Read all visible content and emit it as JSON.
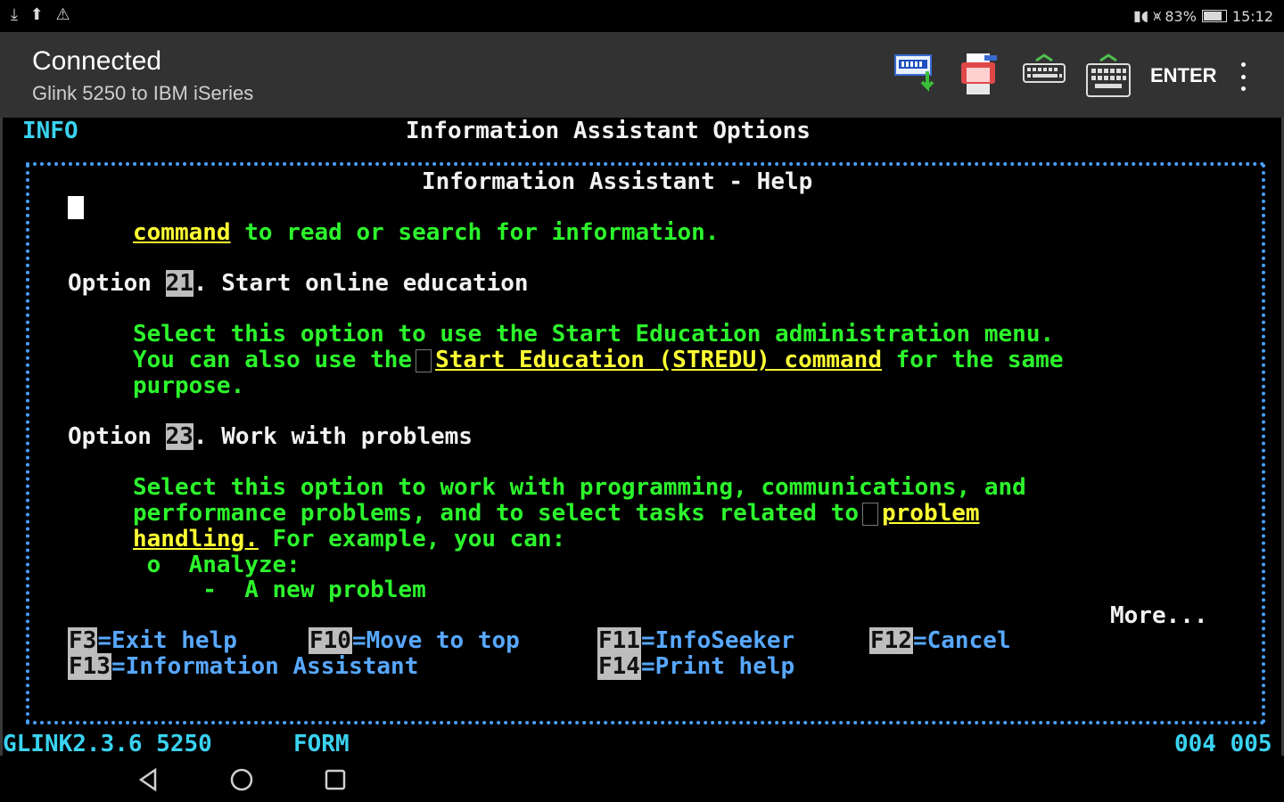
{
  "statusbar": {
    "left_icons": "⤓ ⬆ ⚠",
    "signal_icons": "▮◖ ⩙",
    "battery_text": "83%",
    "time": "15:12"
  },
  "appbar": {
    "title": "Connected",
    "subtitle": "Glink 5250 to IBM iSeries",
    "enter_label": "ENTER",
    "tools": [
      "download-screen-icon",
      "print-icon",
      "keyboard-hide-icon",
      "keyboard-show-icon",
      "overflow-menu-icon"
    ]
  },
  "terminal": {
    "header_left": "INFO",
    "header_title": "Information Assistant Options",
    "window_title": "Information Assistant - Help",
    "line_cmd_link": "command",
    "line_cmd_rest": " to read or search for information.",
    "opt21": {
      "prefix": "Option ",
      "num": "21",
      "title": ". Start online education",
      "line1": "Select this option to use the Start Education administration menu.",
      "line2_pre": "You can also use the",
      "line2_link": "Start Education (STREDU) command",
      "line2_post": " for the same",
      "line3": "purpose."
    },
    "opt23": {
      "prefix": "Option ",
      "num": "23",
      "title": ". Work with problems",
      "line1": "Select this option to work with programming, communications, and",
      "line2_pre": "performance problems, and to select tasks related to",
      "line2_link": "problem",
      "line3_link": "handling.",
      "line3_post": " For example, you can:",
      "bullet1": " o  Analyze:",
      "bullet2": "     -  A new problem"
    },
    "more": "More...",
    "fkeys_row1": [
      {
        "key": "F3",
        "label": "=Exit help"
      },
      {
        "key": "F10",
        "label": "=Move to top"
      },
      {
        "key": "F11",
        "label": "=InfoSeeker"
      },
      {
        "key": "F12",
        "label": "=Cancel"
      }
    ],
    "fkeys_row2": [
      {
        "key": "F13",
        "label": "=Information Assistant"
      },
      {
        "key": "F14",
        "label": "=Print help"
      }
    ],
    "status_left": "GLINK2.3.6 5250",
    "status_mode": "FORM",
    "status_pos": "004 005"
  },
  "colors": {
    "terminal_cyan": "#3ad2f0",
    "terminal_green": "#2cf52c",
    "terminal_yellow": "#ffff33",
    "terminal_blue": "#58a8ff",
    "appbar_bg": "#323232"
  }
}
